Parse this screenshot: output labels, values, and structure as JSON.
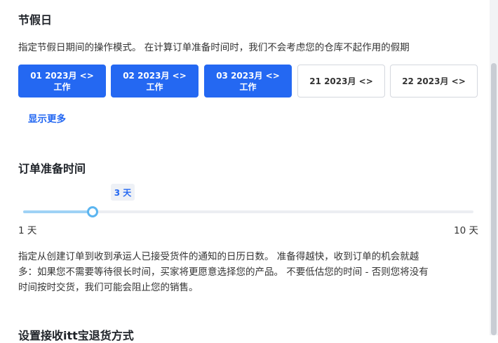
{
  "holiday": {
    "title": "节假日",
    "description": "指定节假日期间的操作模式。 在计算订单准备时间时，我们不会考虑您的仓库不起作用的假期",
    "days": [
      {
        "line1": "01 2023月 <>",
        "line2": "工作",
        "active": true
      },
      {
        "line1": "02 2023月 <>",
        "line2": "工作",
        "active": true
      },
      {
        "line1": "03 2023月 <>",
        "line2": "工作",
        "active": true
      },
      {
        "line1": "21 2023月 <>",
        "line2": "",
        "active": false
      },
      {
        "line1": "22 2023月 <>",
        "line2": "",
        "active": false
      }
    ],
    "show_more": "显示更多"
  },
  "prep": {
    "title": "订单准备时间",
    "slider": {
      "value_label": "3 天",
      "min_label": "1 天",
      "max_label": "10 天",
      "min": 1,
      "max": 10,
      "value": 3
    },
    "description_lines": [
      "指定从创建订单到收到承运人已接受货件的通知的日历日数。 准备得越快，收到订单的机会就越",
      "多：如果您不需要等待很长时间，买家将更愿意选择您的产品。 不要低估您的时间 - 否则您将没有",
      "时间按时交货，我们可能会阻止您的销售。"
    ]
  },
  "returns": {
    "title": "设置接收itt宝退货方式"
  },
  "colors": {
    "accent": "#2468f2",
    "slider_fill": "#9fd2f5",
    "slider_handle": "#5bb5f0"
  }
}
